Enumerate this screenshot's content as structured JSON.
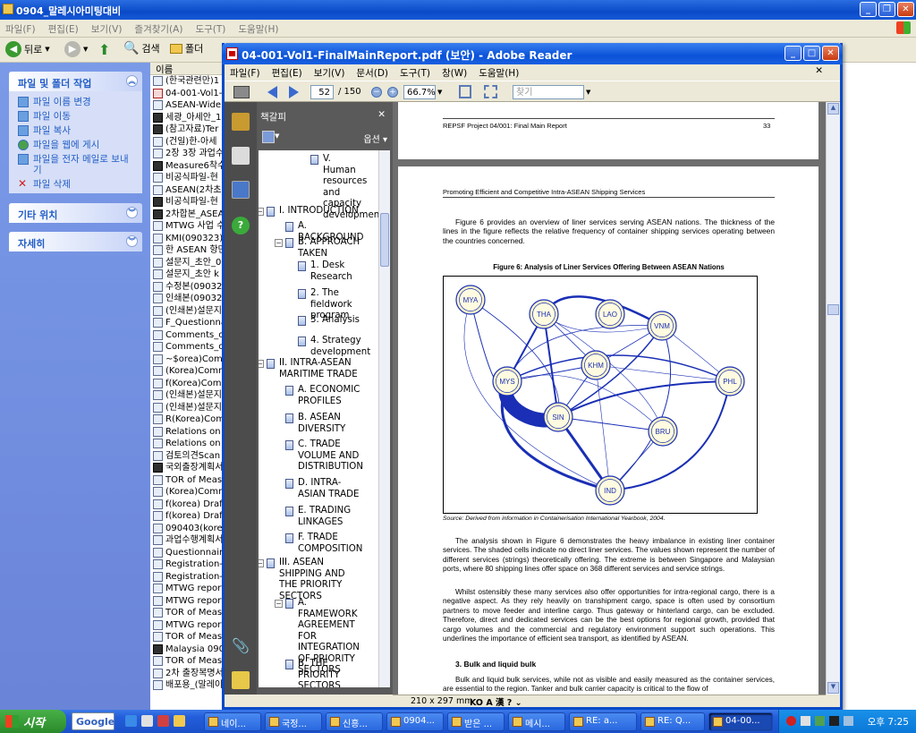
{
  "explorer": {
    "title": "0904_말레시아미팅대비",
    "menu": [
      "파일(F)",
      "편집(E)",
      "보기(V)",
      "즐겨찾기(A)",
      "도구(T)",
      "도움말(H)"
    ],
    "toolbar": {
      "back": "뒤로",
      "search": "검색",
      "folders": "폴더"
    },
    "tasks_title": "파일 및 폴더 작업",
    "tasks": [
      "파일 이름 변경",
      "파일 이동",
      "파일 복사",
      "파일을 웹에 게시",
      "파일을 전자 메일로 보내기",
      "파일 삭제"
    ],
    "other_places": "기타 위치",
    "details": "자세히",
    "col_name": "이름",
    "files": [
      "(한국관련만)1",
      "04-001-Vol1-F",
      "ASEAN-Wide",
      "세광_아세안_1",
      "(참고자료)Ter",
      "(건일)한-아세",
      "2장 3장 과업수",
      "Measure6착수",
      "비공식파일-현",
      "ASEAN(2차초",
      "비공식파일-현",
      "2차합본_ASEA",
      "MTWG 사업 수",
      "KMI(090323)_한",
      "한 ASEAN 항만",
      "설문지_초안_0",
      "설문지_초안 k",
      "수정본(09032",
      "인쇄본(09032",
      "(인쇄본)설문지",
      "F_Questionna",
      "Comments_on",
      "Comments_on",
      "~$orea)Comm",
      "(Korea)Comm",
      "f(Korea)Comm",
      "(인쇄본)설문지",
      "(인쇄본)설문지",
      "R(Korea)Com",
      "Relations on N",
      "Relations on N",
      "검토의견Scan",
      "국외출장계획서",
      "TOR of Measu",
      "(Korea)Comm",
      "f(korea) Draft",
      "f(korea) Draft",
      "090403(korea)",
      "과업수행계획서",
      "Questionnaire",
      "Registration-H",
      "Registration-K",
      "MTWG report_",
      "MTWG report_",
      "TOR of Measu",
      "MTWG report_",
      "TOR of Measu",
      "Malaysia 0904",
      "TOR of Measu",
      "2차 출장복명서",
      "배포용_(말레이"
    ]
  },
  "reader": {
    "title": "04-001-Vol1-FinalMainReport.pdf (보안) - Adobe Reader",
    "menu": [
      "파일(F)",
      "편집(E)",
      "보기(V)",
      "문서(D)",
      "도구(T)",
      "창(W)",
      "도움말(H)"
    ],
    "page": "52",
    "page_total": "/ 150",
    "zoom": "66.7%",
    "find_placeholder": "찾기",
    "bm_title": "책갈피",
    "bm_options": "옵션",
    "bookmarks": [
      "V. Human resources and capacity development",
      "I. INTRODUCTION",
      "A. BACKGROUND",
      "B. APPROACH TAKEN",
      "1. Desk Research",
      "2. The fieldwork program",
      "3. Analysis",
      "4. Strategy development",
      "II. INTRA-ASEAN MARITIME TRADE",
      "A. ECONOMIC PROFILES",
      "B. ASEAN DIVERSITY",
      "C. TRADE VOLUME AND DISTRIBUTION",
      "D. INTRA-ASIAN TRADE",
      "E. TRADING LINKAGES",
      "F. TRADE COMPOSITION",
      "III. ASEAN SHIPPING AND THE PRIORITY SECTORS",
      "A. FRAMEWORK AGREEMENT FOR INTEGRATION OF PRIORITY SECTORS",
      "B. THE PRIORITY SECTORS AND"
    ],
    "page_size": "210 x 297 mm"
  },
  "doc": {
    "hdr_prev": "REPSF Project 04/001: Final Main Report",
    "pagenum_prev": "33",
    "hdr": "Promoting Efficient and Competitive Intra-ASEAN Shipping Services",
    "para1": "Figure 6 provides an overview of liner services serving ASEAN nations.  The thickness of the lines in the figure reflects the relative frequency of container shipping services operating between the countries concerned.",
    "fig_title": "Figure 6: Analysis of Liner Services Offering Between ASEAN Nations",
    "nodes": [
      "MYA",
      "THA",
      "LAO",
      "VNM",
      "KHM",
      "MYS",
      "PHL",
      "SIN",
      "BRU",
      "IND"
    ],
    "source": "Source: Derived from information in Containerisation International Yearbook, 2004.",
    "para2": "The analysis shown in Figure 6 demonstrates the heavy imbalance in existing liner container services. The shaded cells indicate no direct liner services. The values shown represent the number of different services (strings) theoretically offering. The extreme is between Singapore and Malaysian ports, where 80 shipping lines offer space on 368 different services and service strings.",
    "para3": "Whilst ostensibly these many services also offer opportunities for intra-regional cargo, there is a negative aspect. As they rely heavily on transhipment cargo, space is often used by consortium partners to move feeder and interline cargo. Thus gateway or hinterland cargo, can be excluded. Therefore, direct and dedicated services can be the best options for regional growth, provided that cargo volumes and the commercial and regulatory environment support such operations. This underlines the importance of efficient sea transport, as identified by ASEAN.",
    "h3": "3.   Bulk and liquid bulk",
    "para4": "Bulk and liquid bulk services, while not as visible and easily measured as the container services, are essential to the region. Tanker and bulk carrier capacity is critical to the flow of"
  },
  "taskbar": {
    "start": "시작",
    "google": "Google",
    "buttons": [
      "네이...",
      "국정...",
      "신흥...",
      "0904...",
      "받은 ...",
      "메시...",
      "RE: a...",
      "RE: Q...",
      "04-00..."
    ],
    "clock": "오후 7:25"
  }
}
